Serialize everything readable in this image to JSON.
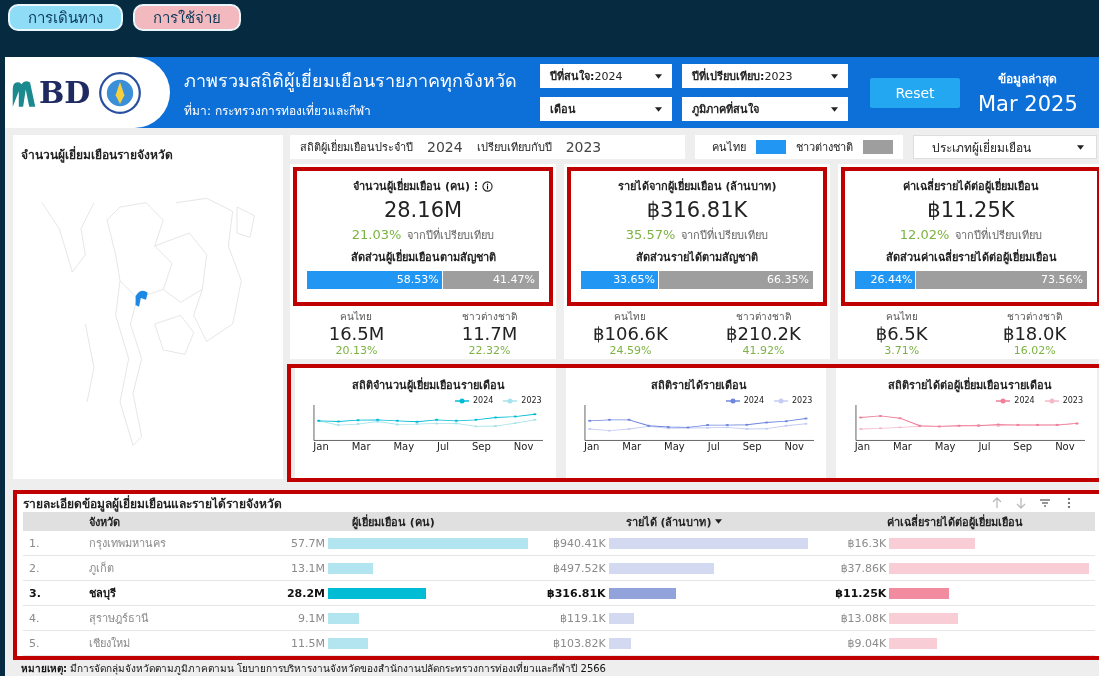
{
  "nav_tabs": [
    {
      "label": "การเดินทาง",
      "color": "#8fdcf6"
    },
    {
      "label": "การใช้จ่าย",
      "color": "#f2b9bf"
    }
  ],
  "header": {
    "logo_text": "BD",
    "title": "ภาพรวมสถิติผู้เยี่ยมเยือนรายภาคทุกจังหวัด",
    "source": "ที่มา: กระทรวงการท่องเที่ยวและกีฬา"
  },
  "filters": [
    {
      "label": "ปีที่สนใจ:",
      "value": "2024"
    },
    {
      "label": "ปีที่เปรียบเทียบ:",
      "value": "2023"
    },
    {
      "label": "เดือน"
    },
    {
      "label": "ภูมิภาคที่สนใจ"
    }
  ],
  "reset_button": "Reset",
  "latest": {
    "label": "ข้อมูลล่าสุด",
    "value": "Mar 2025"
  },
  "map_panel": {
    "title": "จำนวนผู้เยี่ยมเยือนรายจังหวัด"
  },
  "summary_bar": {
    "label": "สถิติผู้เยี่ยมเยือนประจำปี",
    "year": "2024",
    "compare_label": "เปรียบเทียบกับปี",
    "compare_year": "2023"
  },
  "legend": [
    {
      "label": "คนไทย",
      "color": "#2196f3"
    },
    {
      "label": "ชาวต่างชาติ",
      "color": "#9e9e9e"
    }
  ],
  "type_dropdown": "ประเภทผู้เยี่ยมเยือน",
  "kpis": [
    {
      "title": "จำนวนผู้เยี่ยมเยือน (คน)",
      "has_menu": true,
      "value": "28.16M",
      "change": "21.03%",
      "change_label": "จากปีที่เปรียบเทียบ",
      "share_title": "สัดส่วนผู้เยี่ยมเยือนตามสัญชาติ",
      "share": {
        "level": 0.5853,
        "thai_label": "58.53%",
        "foreign_label": "41.47%"
      },
      "highlight": true,
      "breakdown": [
        {
          "label": "คนไทย",
          "value": "16.5M",
          "change": "20.13%"
        },
        {
          "label": "ชาวต่างชาติ",
          "value": "11.7M",
          "change": "22.32%"
        }
      ]
    },
    {
      "title": "รายได้จากผู้เยี่ยมเยือน (ล้านบาท)",
      "has_menu": false,
      "value": "฿316.81K",
      "change": "35.57%",
      "change_label": "จากปีที่เปรียบเทียบ",
      "share_title": "สัดส่วนรายได้ตามสัญชาติ",
      "share": {
        "level": 0.3365,
        "thai_label": "33.65%",
        "foreign_label": "66.35%"
      },
      "highlight": true,
      "breakdown": [
        {
          "label": "คนไทย",
          "value": "฿106.6K",
          "change": "24.59%"
        },
        {
          "label": "ชาวต่างชาติ",
          "value": "฿210.2K",
          "change": "41.92%"
        }
      ]
    },
    {
      "title": "ค่าเฉลี่ยรายได้ต่อผู้เยี่ยมเยือน",
      "has_menu": false,
      "value": "฿11.25K",
      "change": "12.02%",
      "change_label": "จากปีที่เปรียบเทียบ",
      "share_title": "สัดส่วนค่าเฉลี่ยรายได้ต่อผู้เยี่ยมเยือน",
      "share": {
        "level": 0.2644,
        "thai_label": "26.44%",
        "foreign_label": "73.56%"
      },
      "highlight": true,
      "breakdown": [
        {
          "label": "คนไทย",
          "value": "฿6.5K",
          "change": "3.71%"
        },
        {
          "label": "ชาวต่างชาติ",
          "value": "฿18.0K",
          "change": "16.02%"
        }
      ]
    }
  ],
  "charts_highlight": true,
  "charts": [
    {
      "title": "สถิติจำนวนผู้เยี่ยมเยือนรายเดือน",
      "x_labels": [
        "Jan",
        "Mar",
        "May",
        "Jul",
        "Sep",
        "Nov"
      ],
      "series": [
        {
          "name": "2024",
          "color": "#00bcd4"
        },
        {
          "name": "2023",
          "color": "#a6e3ea"
        }
      ]
    },
    {
      "title": "สถิติรายได้รายเดือน",
      "x_labels": [
        "Jan",
        "Mar",
        "May",
        "Jul",
        "Sep",
        "Nov"
      ],
      "series": [
        {
          "name": "2024",
          "color": "#6f86e0"
        },
        {
          "name": "2023",
          "color": "#c5cdf5"
        }
      ]
    },
    {
      "title": "สถิติรายได้ต่อผู้เยี่ยมเยือนรายเดือน",
      "x_labels": [
        "Jan",
        "Mar",
        "May",
        "Jul",
        "Sep",
        "Nov"
      ],
      "series": [
        {
          "name": "2024",
          "color": "#f07f98"
        },
        {
          "name": "2023",
          "color": "#f5b8c8"
        }
      ]
    }
  ],
  "table": {
    "title": "รายละเอียดข้อมูลผู้เยี่ยมเยือนและรายได้รายจังหวัด",
    "highlight": true,
    "columns": [
      {
        "label": "จังหวัด",
        "sorted": false
      },
      {
        "label": "ผู้เยี่ยมเยือน (คน)",
        "sorted": false
      },
      {
        "label": "รายได้ (ล้านบาท)",
        "sorted": true
      },
      {
        "label": "ค่าเฉลี่ยรายได้ต่อผู้เยี่ยมเยือน",
        "sorted": false
      }
    ],
    "rows": [
      {
        "index": "1.",
        "province": "กรุงเทพมหานคร",
        "selected": false,
        "metrics": [
          "57.7M",
          "฿940.41K",
          "฿16.3K"
        ]
      },
      {
        "index": "2.",
        "province": "ภูเก็ต",
        "selected": false,
        "metrics": [
          "13.1M",
          "฿497.52K",
          "฿37.86K"
        ]
      },
      {
        "index": "3.",
        "province": "ชลบุรี",
        "selected": true,
        "metrics": [
          "28.2M",
          "฿316.81K",
          "฿11.25K"
        ]
      },
      {
        "index": "4.",
        "province": "สุราษฎร์ธานี",
        "selected": false,
        "metrics": [
          "9.1M",
          "฿119.1K",
          "฿13.08K"
        ]
      },
      {
        "index": "5.",
        "province": "เชียงใหม่",
        "selected": false,
        "metrics": [
          "11.5M",
          "฿103.82K",
          "฿9.04K"
        ]
      }
    ]
  },
  "note": "**หมายเหตุ:** มีการจัดกลุ่มจังหวัดตามภูมิภาคตามน โยบายการบริหารงานจังหวัดของสำนักงานปลัดกระทรวงการท่องเที่ยวและกีฬาปี 2566"
}
